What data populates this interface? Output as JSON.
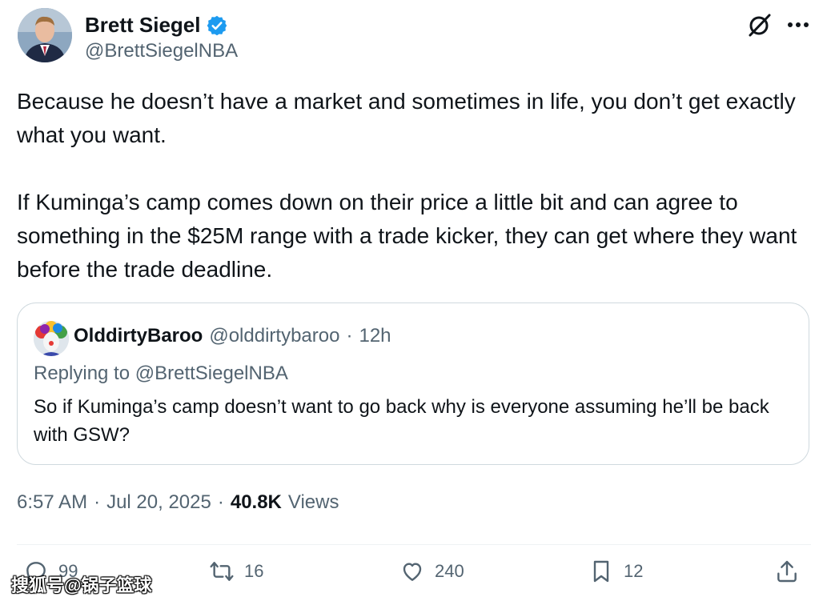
{
  "author": {
    "display_name": "Brett Siegel",
    "handle": "@BrettSiegelNBA",
    "avatar_icon": "profile-photo-man-in-suit",
    "verified_icon": "verified-badge-icon",
    "verified_color": "#1d9bf0"
  },
  "header_actions": {
    "grok_icon": "grok-icon",
    "more_icon": "more-icon"
  },
  "tweet": {
    "text": "Because he doesn’t have a market and sometimes in life, you don’t get exactly what you want.\n\nIf Kuminga’s camp comes down on their price a little bit and can agree to something in the $25M range with a trade kicker, they can get where they want before the trade deadline."
  },
  "quote": {
    "avatar_icon": "profile-photo-clown",
    "display_name": "OlddirtyBaroo",
    "handle": "@olddirtybaroo",
    "separator": "·",
    "time": "12h",
    "replying_to": "Replying to @BrettSiegelNBA",
    "text": "So if Kuminga’s camp doesn’t want to go back why is everyone assuming he’ll be back with GSW?"
  },
  "meta": {
    "time": "6:57 AM",
    "sep1": "·",
    "date": "Jul 20, 2025",
    "sep2": "·",
    "views_count": "40.8K",
    "views_label": "Views"
  },
  "actions": {
    "reply_count": "99",
    "retweet_count": "16",
    "like_count": "240",
    "bookmark_count": "12"
  },
  "watermark": "搜狐号@锅子篮球",
  "colors": {
    "text": "#0f1419",
    "secondary": "#536471",
    "border": "#cfd9de",
    "accent": "#1d9bf0"
  }
}
